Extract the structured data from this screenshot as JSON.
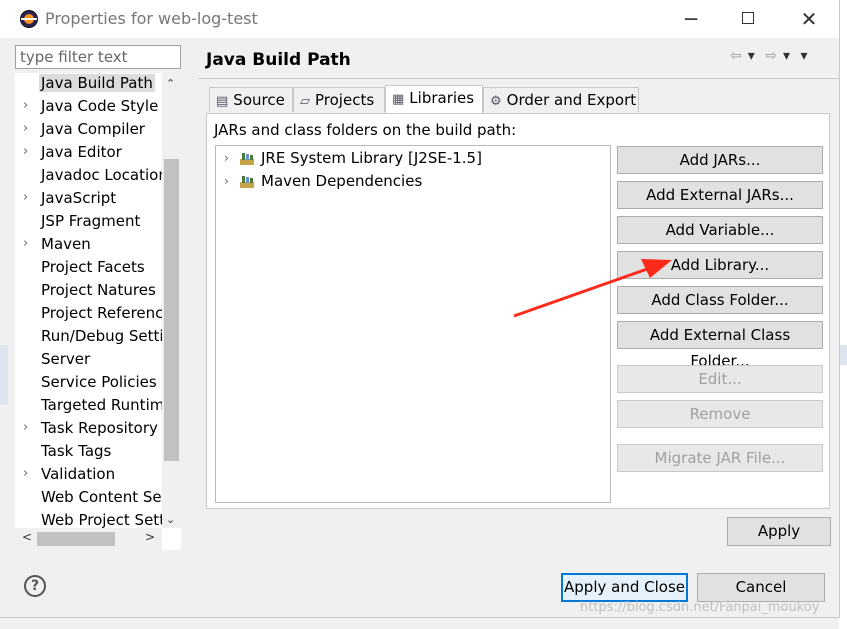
{
  "window": {
    "title": "Properties for web-log-test",
    "minimize": "─",
    "close": "✕"
  },
  "filter": {
    "placeholder": "type filter text",
    "value": ""
  },
  "tree": {
    "items": [
      {
        "label": "Java Build Path",
        "expandable": false,
        "selected": true
      },
      {
        "label": "Java Code Style",
        "expandable": true
      },
      {
        "label": "Java Compiler",
        "expandable": true
      },
      {
        "label": "Java Editor",
        "expandable": true
      },
      {
        "label": "Javadoc Location",
        "expandable": false
      },
      {
        "label": "JavaScript",
        "expandable": true
      },
      {
        "label": "JSP Fragment",
        "expandable": false
      },
      {
        "label": "Maven",
        "expandable": true
      },
      {
        "label": "Project Facets",
        "expandable": false
      },
      {
        "label": "Project Natures",
        "expandable": false
      },
      {
        "label": "Project References",
        "expandable": false
      },
      {
        "label": "Run/Debug Settings",
        "expandable": false
      },
      {
        "label": "Server",
        "expandable": false
      },
      {
        "label": "Service Policies",
        "expandable": false
      },
      {
        "label": "Targeted Runtimes",
        "expandable": false
      },
      {
        "label": "Task Repository",
        "expandable": true
      },
      {
        "label": "Task Tags",
        "expandable": false
      },
      {
        "label": "Validation",
        "expandable": true
      },
      {
        "label": "Web Content Settings",
        "expandable": false
      },
      {
        "label": "Web Project Settings",
        "expandable": false
      }
    ]
  },
  "page": {
    "title": "Java Build Path"
  },
  "tabs": [
    {
      "label": "Source",
      "icon": "source-folder-icon"
    },
    {
      "label": "Projects",
      "icon": "projects-folder-icon"
    },
    {
      "label": "Libraries",
      "icon": "libraries-icon",
      "active": true
    },
    {
      "label": "Order and Export",
      "icon": "order-export-icon"
    }
  ],
  "libraries": {
    "label": "JARs and class folders on the build path:",
    "entries": [
      {
        "label": "JRE System Library [J2SE-1.5]",
        "icon": "library-icon"
      },
      {
        "label": "Maven Dependencies",
        "icon": "library-icon"
      }
    ]
  },
  "buttons": {
    "add_jars": "Add JARs...",
    "add_external_jars": "Add External JARs...",
    "add_variable": "Add Variable...",
    "add_library": "Add Library...",
    "add_class_folder": "Add Class Folder...",
    "add_external_class_folder": "Add External Class Folder...",
    "edit": "Edit...",
    "remove": "Remove",
    "migrate_jar": "Migrate JAR File...",
    "apply": "Apply",
    "apply_and_close": "Apply and Close",
    "cancel": "Cancel",
    "help": "?"
  },
  "watermark": "https://blog.csdn.net/Fanpai_moukoy",
  "colors": {
    "annotation_arrow": "#ff2a1a",
    "focus_border": "#0078d7"
  }
}
